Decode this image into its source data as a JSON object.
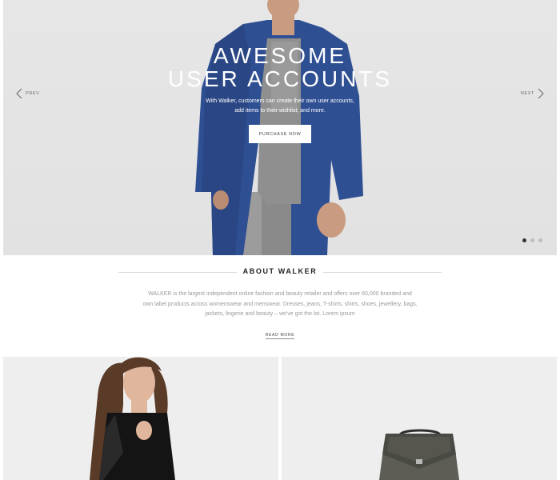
{
  "hero": {
    "title_line1": "AWESOME",
    "title_line2": "USER ACCOUNTS",
    "desc_line1": "With Walker, customers can create their own user accounts,",
    "desc_line2": "add items to their wishlist, and more.",
    "cta_label": "PURCHASE NOW",
    "prev_label": "PREV",
    "next_label": "NEXT",
    "slide_count": 3,
    "active_slide": 1
  },
  "about": {
    "title": "ABOUT WALKER",
    "text_line1": "WALKER is the largest independent online fashion and beauty retailer and offers over 60,000 branded and",
    "text_line2": "own label products across womenswear and menswear. Dresses, jeans, T-shirts, shirts, shoes, jewellery, bags,",
    "text_line3": "jackets, lingerie and beauty – we've got the lot. Lorem ipsum",
    "read_more_label": "READ MORE"
  },
  "colors": {
    "hero_bg": "#e4e4e4",
    "jacket": "#2f4f93",
    "text_muted": "#9a9a9a",
    "dot_active": "#333333",
    "dot_inactive": "#bdbdbd"
  },
  "icons": {
    "prev": "chevron-left-icon",
    "next": "chevron-right-icon"
  }
}
